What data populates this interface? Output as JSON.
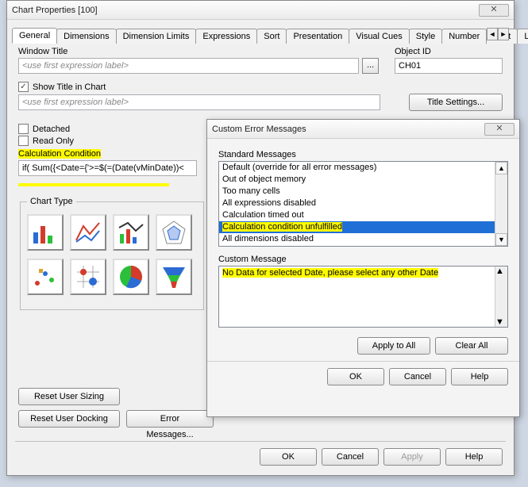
{
  "main": {
    "title": "Chart Properties [100]",
    "tabs": [
      "General",
      "Dimensions",
      "Dimension Limits",
      "Expressions",
      "Sort",
      "Presentation",
      "Visual Cues",
      "Style",
      "Number",
      "Font",
      "La"
    ],
    "active_tab": 0,
    "window_title_label": "Window Title",
    "window_title_value": "<use first expression label>",
    "object_id_label": "Object ID",
    "object_id_value": "CH01",
    "show_title_label": "Show Title in Chart",
    "show_title_checked": true,
    "show_title_value": "<use first expression label>",
    "title_settings_btn": "Title Settings...",
    "detached_label": "Detached",
    "readonly_label": "Read Only",
    "calc_cond_label": "Calculation Condition",
    "calc_cond_value": "if( Sum({<Date={'>=$(=(Date(vMinDate))<",
    "chart_type_label": "Chart Type",
    "reset_sizing_btn": "Reset User Sizing",
    "reset_docking_btn": "Reset User Docking",
    "error_msgs_btn": "Error Messages...",
    "ok": "OK",
    "cancel": "Cancel",
    "apply": "Apply",
    "help": "Help"
  },
  "sub": {
    "title": "Custom Error Messages",
    "std_label": "Standard Messages",
    "std_items": [
      "Default (override for all error messages)",
      "Out of object memory",
      "Too many cells",
      "All expressions disabled",
      "Calculation timed out",
      "Calculation condition unfulfilled",
      "All dimensions disabled"
    ],
    "std_selected_index": 5,
    "custom_label": "Custom Message",
    "custom_value": "No Data for selected Date, please select any other Date",
    "apply_all": "Apply to All",
    "clear_all": "Clear All",
    "ok": "OK",
    "cancel": "Cancel",
    "help": "Help"
  }
}
